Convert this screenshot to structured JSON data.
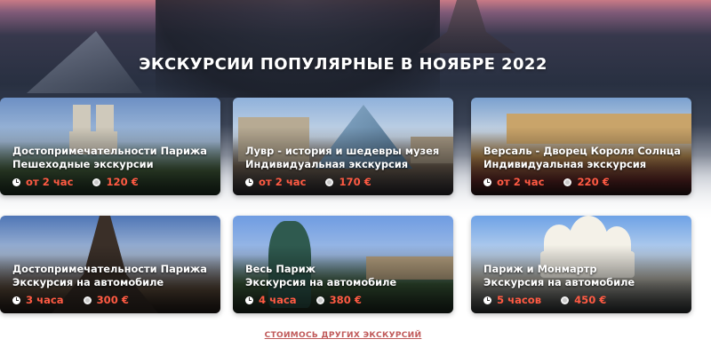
{
  "page": {
    "title": "ЭКСКУРСИИ ПОПУЛЯРНЫЕ В НОЯБРЕ 2022",
    "more_link": "СТОИМОСЬ ДРУГИХ ЭКСКУРСИЙ"
  },
  "tours": [
    {
      "title_line1": "Достопримечательности Парижа",
      "title_line2": "Пешеходные экскурсии",
      "duration": "от 2 час",
      "price": "120 €",
      "image_icon": "notre-dame-photo"
    },
    {
      "title_line1": "Лувр - история и шедевры музея",
      "title_line2": "Индивидуальная экскурсия",
      "duration": "от 2 час",
      "price": "170 €",
      "image_icon": "louvre-photo"
    },
    {
      "title_line1": "Версаль - Дворец Короля Солнца",
      "title_line2": "Индивидуальная экскурсия",
      "duration": "от 2 час",
      "price": "220 €",
      "image_icon": "versailles-photo"
    },
    {
      "title_line1": "Достопримечательности Парижа",
      "title_line2": "Экскурсия на автомобиле",
      "duration": "3 часа",
      "price": "300 €",
      "image_icon": "eiffel-tower-photo"
    },
    {
      "title_line1": "Весь Париж",
      "title_line2": "Экскурсия на автомобиле",
      "duration": "4 часа",
      "price": "380 €",
      "image_icon": "statue-photo"
    },
    {
      "title_line1": "Париж и Монмартр",
      "title_line2": "Экскурсия на автомобиле",
      "duration": "5 часов",
      "price": "450 €",
      "image_icon": "sacre-coeur-photo"
    }
  ],
  "colors": {
    "accent_price": "#ff5a43",
    "link": "#c05a5a"
  }
}
